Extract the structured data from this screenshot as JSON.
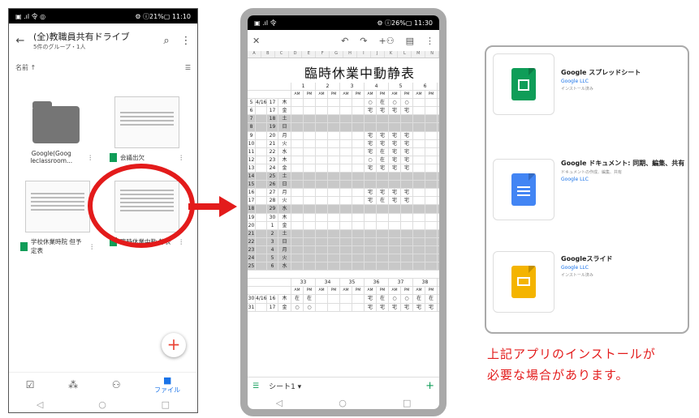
{
  "drive": {
    "status_left": "▣ .ıl 令 ◎",
    "status_right": "⚙ ⓘ21%▢ 11:10",
    "title": "(全)教職員共有ドライブ",
    "subtitle": "5件のグループ・1人",
    "sort_label": "名前 ↑",
    "files": [
      {
        "label": "Google(Goog leclassroom..."
      },
      {
        "label": "会議出欠"
      },
      {
        "label": "学校休業時院 但予定表"
      },
      {
        "label": "臨時休業中勤 静表"
      }
    ],
    "nav_files_label": "ファイル"
  },
  "sheets": {
    "status_left": "▣ .ıl 令",
    "status_right": "⚙ ⓘ26%▢ 11:30",
    "title": "臨時休業中動静表",
    "tab_label": "シート1 ▾",
    "col_headers": [
      "A",
      "B",
      "C",
      "D",
      "E",
      "F",
      "G",
      "H",
      "I",
      "J",
      "K",
      "L",
      "M",
      "N"
    ],
    "week_numbers": [
      "1",
      "2",
      "3",
      "4",
      "5",
      "6"
    ],
    "ampm": [
      "AM",
      "PM",
      "AM",
      "PM",
      "AM",
      "PM",
      "AM",
      "PM",
      "AM",
      "PM",
      "AM",
      "PM"
    ],
    "rows": [
      {
        "n": "5",
        "m": "4/16",
        "d": "17",
        "w": "木",
        "gray": false,
        "v": [
          "",
          "",
          "",
          "",
          "",
          "",
          "○",
          "在",
          "○",
          "○",
          "",
          ""
        ]
      },
      {
        "n": "6",
        "m": "",
        "d": "17",
        "w": "金",
        "gray": false,
        "v": [
          "",
          "",
          "",
          "",
          "",
          "",
          "宅",
          "宅",
          "宅",
          "宅",
          "",
          ""
        ]
      },
      {
        "n": "7",
        "m": "",
        "d": "18",
        "w": "土",
        "gray": true,
        "v": []
      },
      {
        "n": "8",
        "m": "",
        "d": "19",
        "w": "日",
        "gray": true,
        "v": []
      },
      {
        "n": "9",
        "m": "",
        "d": "20",
        "w": "月",
        "gray": false,
        "v": [
          "",
          "",
          "",
          "",
          "",
          "",
          "宅",
          "宅",
          "宅",
          "宅",
          "",
          ""
        ]
      },
      {
        "n": "10",
        "m": "",
        "d": "21",
        "w": "火",
        "gray": false,
        "v": [
          "",
          "",
          "",
          "",
          "",
          "",
          "宅",
          "宅",
          "宅",
          "宅",
          "",
          ""
        ]
      },
      {
        "n": "11",
        "m": "",
        "d": "22",
        "w": "水",
        "gray": false,
        "v": [
          "",
          "",
          "",
          "",
          "",
          "",
          "宅",
          "在",
          "宅",
          "宅",
          "",
          ""
        ]
      },
      {
        "n": "12",
        "m": "",
        "d": "23",
        "w": "木",
        "gray": false,
        "v": [
          "",
          "",
          "",
          "",
          "",
          "",
          "○",
          "在",
          "宅",
          "宅",
          "",
          ""
        ]
      },
      {
        "n": "13",
        "m": "",
        "d": "24",
        "w": "金",
        "gray": false,
        "v": [
          "",
          "",
          "",
          "",
          "",
          "",
          "宅",
          "宅",
          "宅",
          "宅",
          "",
          ""
        ]
      },
      {
        "n": "14",
        "m": "",
        "d": "25",
        "w": "土",
        "gray": true,
        "v": []
      },
      {
        "n": "15",
        "m": "",
        "d": "26",
        "w": "日",
        "gray": true,
        "v": []
      },
      {
        "n": "16",
        "m": "",
        "d": "27",
        "w": "月",
        "gray": false,
        "v": [
          "",
          "",
          "",
          "",
          "",
          "",
          "宅",
          "宅",
          "宅",
          "宅",
          "",
          ""
        ]
      },
      {
        "n": "17",
        "m": "",
        "d": "28",
        "w": "火",
        "gray": false,
        "v": [
          "",
          "",
          "",
          "",
          "",
          "",
          "宅",
          "在",
          "宅",
          "宅",
          "",
          ""
        ]
      },
      {
        "n": "18",
        "m": "",
        "d": "29",
        "w": "水",
        "gray": true,
        "v": []
      },
      {
        "n": "19",
        "m": "",
        "d": "30",
        "w": "木",
        "gray": false,
        "v": []
      },
      {
        "n": "20",
        "m": "",
        "d": "1",
        "w": "金",
        "gray": false,
        "v": []
      },
      {
        "n": "21",
        "m": "",
        "d": "2",
        "w": "土",
        "gray": true,
        "v": []
      },
      {
        "n": "22",
        "m": "",
        "d": "3",
        "w": "日",
        "gray": true,
        "v": []
      },
      {
        "n": "23",
        "m": "",
        "d": "4",
        "w": "月",
        "gray": true,
        "v": []
      },
      {
        "n": "24",
        "m": "",
        "d": "5",
        "w": "火",
        "gray": true,
        "v": []
      },
      {
        "n": "25",
        "m": "",
        "d": "6",
        "w": "水",
        "gray": true,
        "v": []
      }
    ],
    "week_numbers_2": [
      "33",
      "34",
      "35",
      "36",
      "37",
      "38"
    ],
    "rows_2": [
      {
        "n": "30",
        "m": "4/16",
        "d": "16",
        "w": "木",
        "gray": false,
        "v": [
          "在",
          "在",
          "",
          "",
          "",
          "",
          "宅",
          "在",
          "○",
          "○",
          "在",
          "在"
        ]
      },
      {
        "n": "31",
        "m": "",
        "d": "17",
        "w": "金",
        "gray": false,
        "v": [
          "○",
          "○",
          "",
          "",
          "",
          "",
          "宅",
          "宅",
          "宅",
          "宅",
          "宅",
          "宅"
        ]
      }
    ]
  },
  "apps": [
    {
      "name": "Google スプレッドシート",
      "badge": "E",
      "dev": "Google LLC",
      "small": "インストール済み",
      "color": "#0f9d58"
    },
    {
      "name": "Google ドキュメント: 同期、編集、共有",
      "badge": "E",
      "dev": "Google LLC",
      "small": "ドキュメントの作成、編集、共有",
      "color": "#4285f4"
    },
    {
      "name": "Googleスライド",
      "badge": "E",
      "dev": "Google LLC",
      "small": "インストール済み",
      "color": "#f4b400"
    }
  ],
  "note": {
    "line1": "上記アプリのインストールが",
    "line2": "必要な場合があります。"
  },
  "colors": {
    "accent_red": "#e31b1b",
    "sheets_green": "#0f9d58"
  }
}
